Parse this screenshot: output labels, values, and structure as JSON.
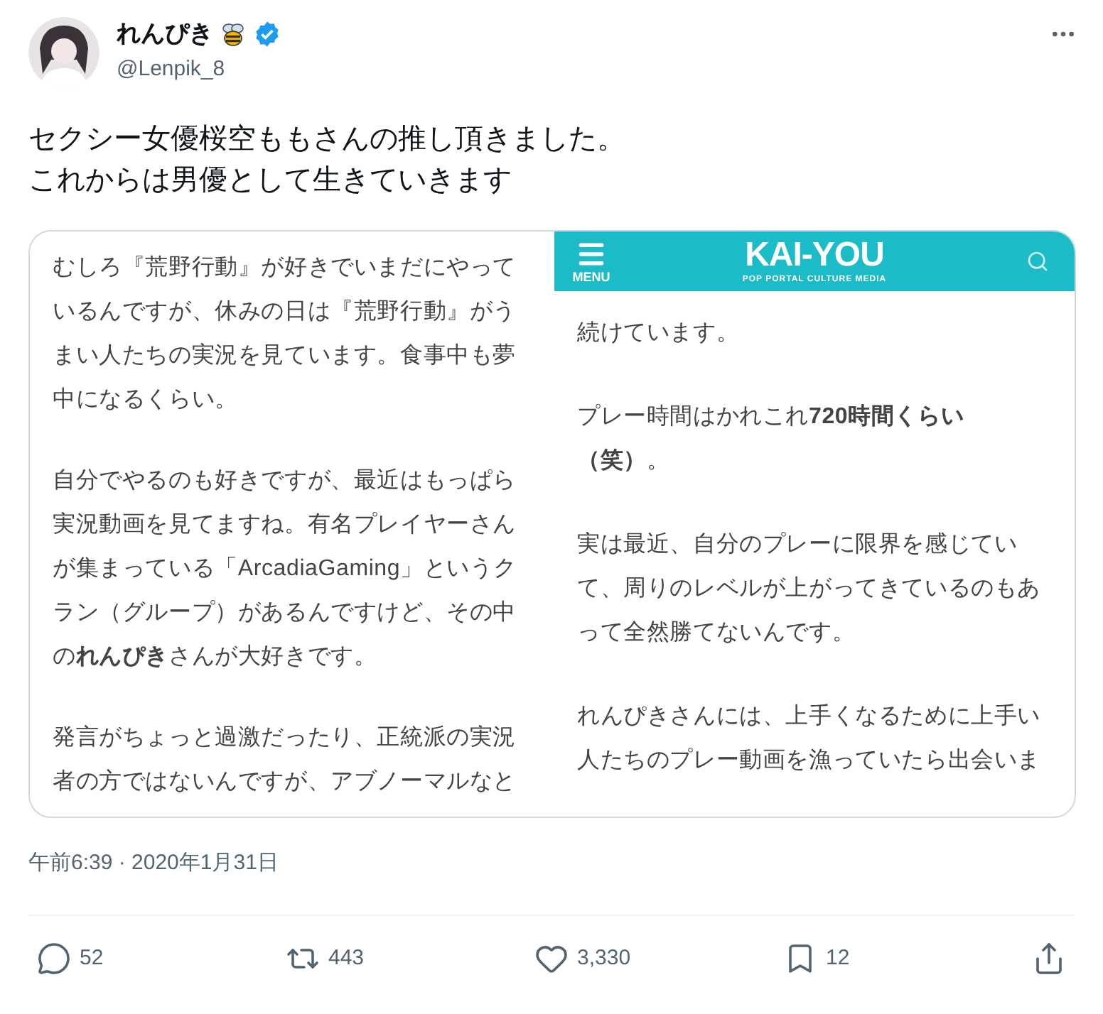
{
  "author": {
    "name": "れんぴき",
    "handle": "@Lenpik_8",
    "verified": true
  },
  "text_lines": [
    "セクシー女優桜空ももさんの推し頂きました。",
    "これからは男優として生きていきます"
  ],
  "image": {
    "left_panel": {
      "paragraphs": [
        [
          "むしろ『荒野行動』が好きでいまだにやって",
          "いるんですが、休みの日は『荒野行動』がう",
          "まい人たちの実況を見ています。食事中も夢",
          "中になるくらい。"
        ],
        [
          "自分でやるのも好きですが、最近はもっぱら",
          "実況動画を見てますね。有名プレイヤーさん",
          "が集まっている「ArcadiaGaming」というク",
          "ラン（グループ）があるんですけど、その中",
          "の**れんぴき**さんが大好きです。"
        ],
        [
          "発言がちょっと過激だったり、正統派の実況",
          "者の方ではないんですが、アブノーマルなと"
        ]
      ]
    },
    "right_panel": {
      "header": {
        "menu_label": "MENU",
        "logo": "KAI-YOU",
        "tagline": "POP PORTAL CULTURE MEDIA"
      },
      "paragraphs": [
        [
          "続けています。"
        ],
        [
          "プレー時間はかれこれ**720時間くらい**",
          "**（笑）**。"
        ],
        [
          "実は最近、自分のプレーに限界を感じてい",
          "て、周りのレベルが上がってきているのもあ",
          "って全然勝てないんです。"
        ],
        [
          "れんぴきさんには、上手くなるために上手い",
          "人たちのプレー動画を漁っていたら出会いま"
        ]
      ]
    }
  },
  "timestamp": "午前6:39 · 2020年1月31日",
  "actions": [
    {
      "kind": "reply",
      "count": "52"
    },
    {
      "kind": "repost",
      "count": "443"
    },
    {
      "kind": "like",
      "count": "3,330"
    },
    {
      "kind": "bookmark",
      "count": "12"
    },
    {
      "kind": "share"
    }
  ]
}
